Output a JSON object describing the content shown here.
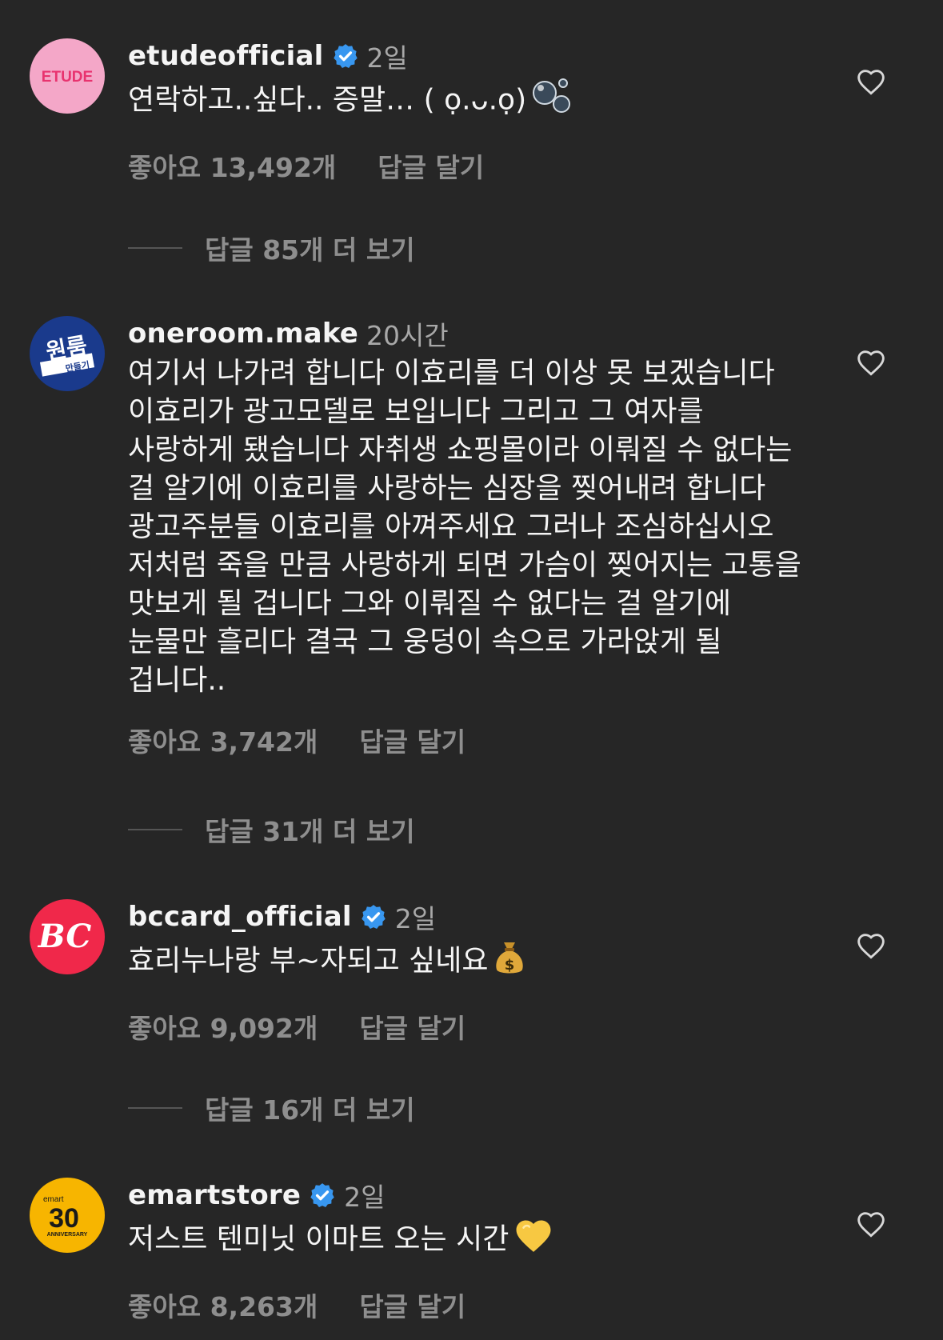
{
  "comments": [
    {
      "username": "etudeofficial",
      "verified": true,
      "time": "2일",
      "text": "연락하고..싶다.. 증말… ( ọ.ᴗ.ọ)",
      "emoji": "bubbles-icon",
      "likes": "좋아요 13,492개",
      "reply": "답글 달기",
      "view_replies": "답글 85개 더 보기",
      "avatar": {
        "label": "ETUDE",
        "bg": "#f4a7c8",
        "fg": "#e8336f"
      }
    },
    {
      "username": "oneroom.make",
      "verified": false,
      "time": "20시간",
      "text": "여기서 나가려 합니다 이효리를 더 이상 못 보겠습니다 이효리가 광고모델로 보입니다 그리고 그 여자를 사랑하게 됐습니다 자취생 쇼핑몰이라 이뤄질 수 없다는 걸 알기에 이효리를 사랑하는 심장을 찢어내려 합니다 광고주분들 이효리를 아껴주세요 그러나 조심하십시오 저처럼 죽을 만큼 사랑하게 되면 가슴이 찢어지는 고통을 맛보게 될 겁니다 그와 이뤄질 수 없다는 걸 알기에 눈물만 흘리다 결국 그 웅덩이 속으로 가라앉게 될 겁니다..",
      "likes": "좋아요 3,742개",
      "reply": "답글 달기",
      "view_replies": "답글 31개 더 보기",
      "avatar": {
        "label": "원룸",
        "sublabel": "만들기",
        "bg": "#1a3a8c",
        "fg": "#ffffff"
      }
    },
    {
      "username": "bccard_official",
      "verified": true,
      "time": "2일",
      "text": "효리누나랑 부~자되고 싶네요",
      "emoji": "money-bag-icon",
      "likes": "좋아요 9,092개",
      "reply": "답글 달기",
      "view_replies": "답글 16개 더 보기",
      "avatar": {
        "label": "BC",
        "bg": "#f0284a",
        "fg": "#ffffff"
      }
    },
    {
      "username": "emartstore",
      "verified": true,
      "time": "2일",
      "text": "저스트 텐미닛 이마트 오는 시간",
      "emoji": "yellow-heart-icon",
      "likes": "좋아요 8,263개",
      "reply": "답글 달기",
      "avatar": {
        "label": "30",
        "brand": "emart",
        "sublabel": "ANNIVERSARY",
        "bg": "#f7b500",
        "fg": "#1a1a1a"
      }
    }
  ],
  "colors": {
    "background": "#262626",
    "text": "#f5f5f5",
    "muted": "#8e8e8e",
    "verified": "#3897f0"
  }
}
